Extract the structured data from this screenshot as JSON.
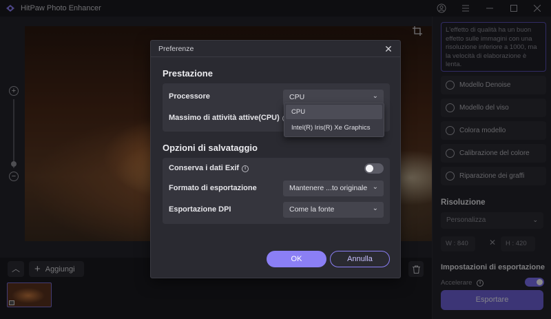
{
  "window": {
    "title": "HitPaw Photo Enhancer",
    "accent": "#8b7ff5"
  },
  "titlebar_icons": [
    "user-icon",
    "menu-icon",
    "minimize-icon",
    "maximize-icon",
    "close-icon"
  ],
  "bottom_bar": {
    "add_label": "Aggiungi"
  },
  "right_panel": {
    "description": "L'effetto di qualità ha un buon effetto sulle immagini con una risoluzione inferiore a 1000, ma la velocità di elaborazione è lenta.",
    "models": [
      {
        "label": "Modello Denoise",
        "icon": "denoise-icon"
      },
      {
        "label": "Modello del viso",
        "icon": "face-icon"
      },
      {
        "label": "Colora modello",
        "icon": "colorize-icon"
      },
      {
        "label": "Calibrazione del colore",
        "icon": "color-calibration-icon"
      },
      {
        "label": "Riparazione dei graffi",
        "icon": "scratch-repair-icon"
      }
    ],
    "resolution_title": "Risoluzione",
    "resolution_select": "Personalizza",
    "width": "W : 840",
    "height": "H : 420",
    "dim_separator": "✕",
    "export_settings_title": "Impostazioni di esportazione",
    "accelerate_label": "Accelerare",
    "accelerate_on": true,
    "export_button": "Esportare"
  },
  "modal": {
    "title": "Preferenze",
    "performance_title": "Prestazione",
    "processor_label": "Processore",
    "processor_value": "CPU",
    "max_tasks_label": "Massimo di attività attive(CPU)",
    "processor_options": [
      "CPU",
      "Intel(R) Iris(R) Xe Graphics"
    ],
    "save_options_title": "Opzioni di salvataggio",
    "exif_label": "Conserva i dati Exif",
    "exif_on": false,
    "format_label": "Formato di esportazione",
    "format_value": "Mantenere ...to originale",
    "dpi_label": "Esportazione DPI",
    "dpi_value": "Come la fonte",
    "ok_label": "OK",
    "cancel_label": "Annulla"
  }
}
